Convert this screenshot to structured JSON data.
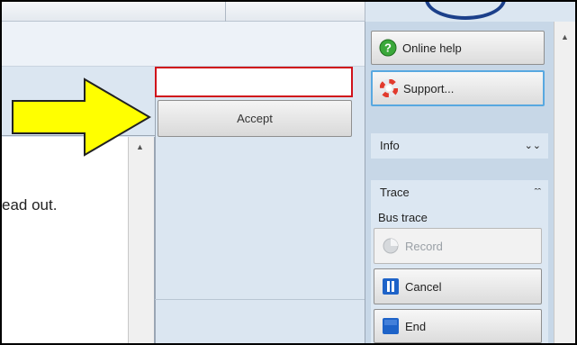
{
  "content": {
    "readout_text": "ead out.",
    "accept_input_value": "",
    "accept_button_label": "Accept"
  },
  "right_panel": {
    "online_help_label": "Online help",
    "support_label": "Support...",
    "info_section": {
      "title": "Info",
      "state": "collapsed"
    },
    "trace_section": {
      "title": "Trace",
      "state": "expanded",
      "bus_trace_label": "Bus trace",
      "record_label": "Record",
      "record_enabled": false,
      "cancel_label": "Cancel",
      "end_label": "End"
    }
  },
  "icons": {
    "online_help": "question-circle-icon",
    "support": "lifebuoy-icon",
    "record": "record-icon",
    "cancel": "pause-icon",
    "end": "stop-icon",
    "expand": "chevron-double-down-icon",
    "collapse": "chevron-double-up-icon",
    "pointer": "arrow-right-icon"
  },
  "colors": {
    "highlight_box": "#d0121b",
    "arrow_fill": "#ffff00",
    "panel_bg": "#c7d7e7",
    "focus_border": "#58a8e0",
    "media_blue": "#1e63c8"
  }
}
